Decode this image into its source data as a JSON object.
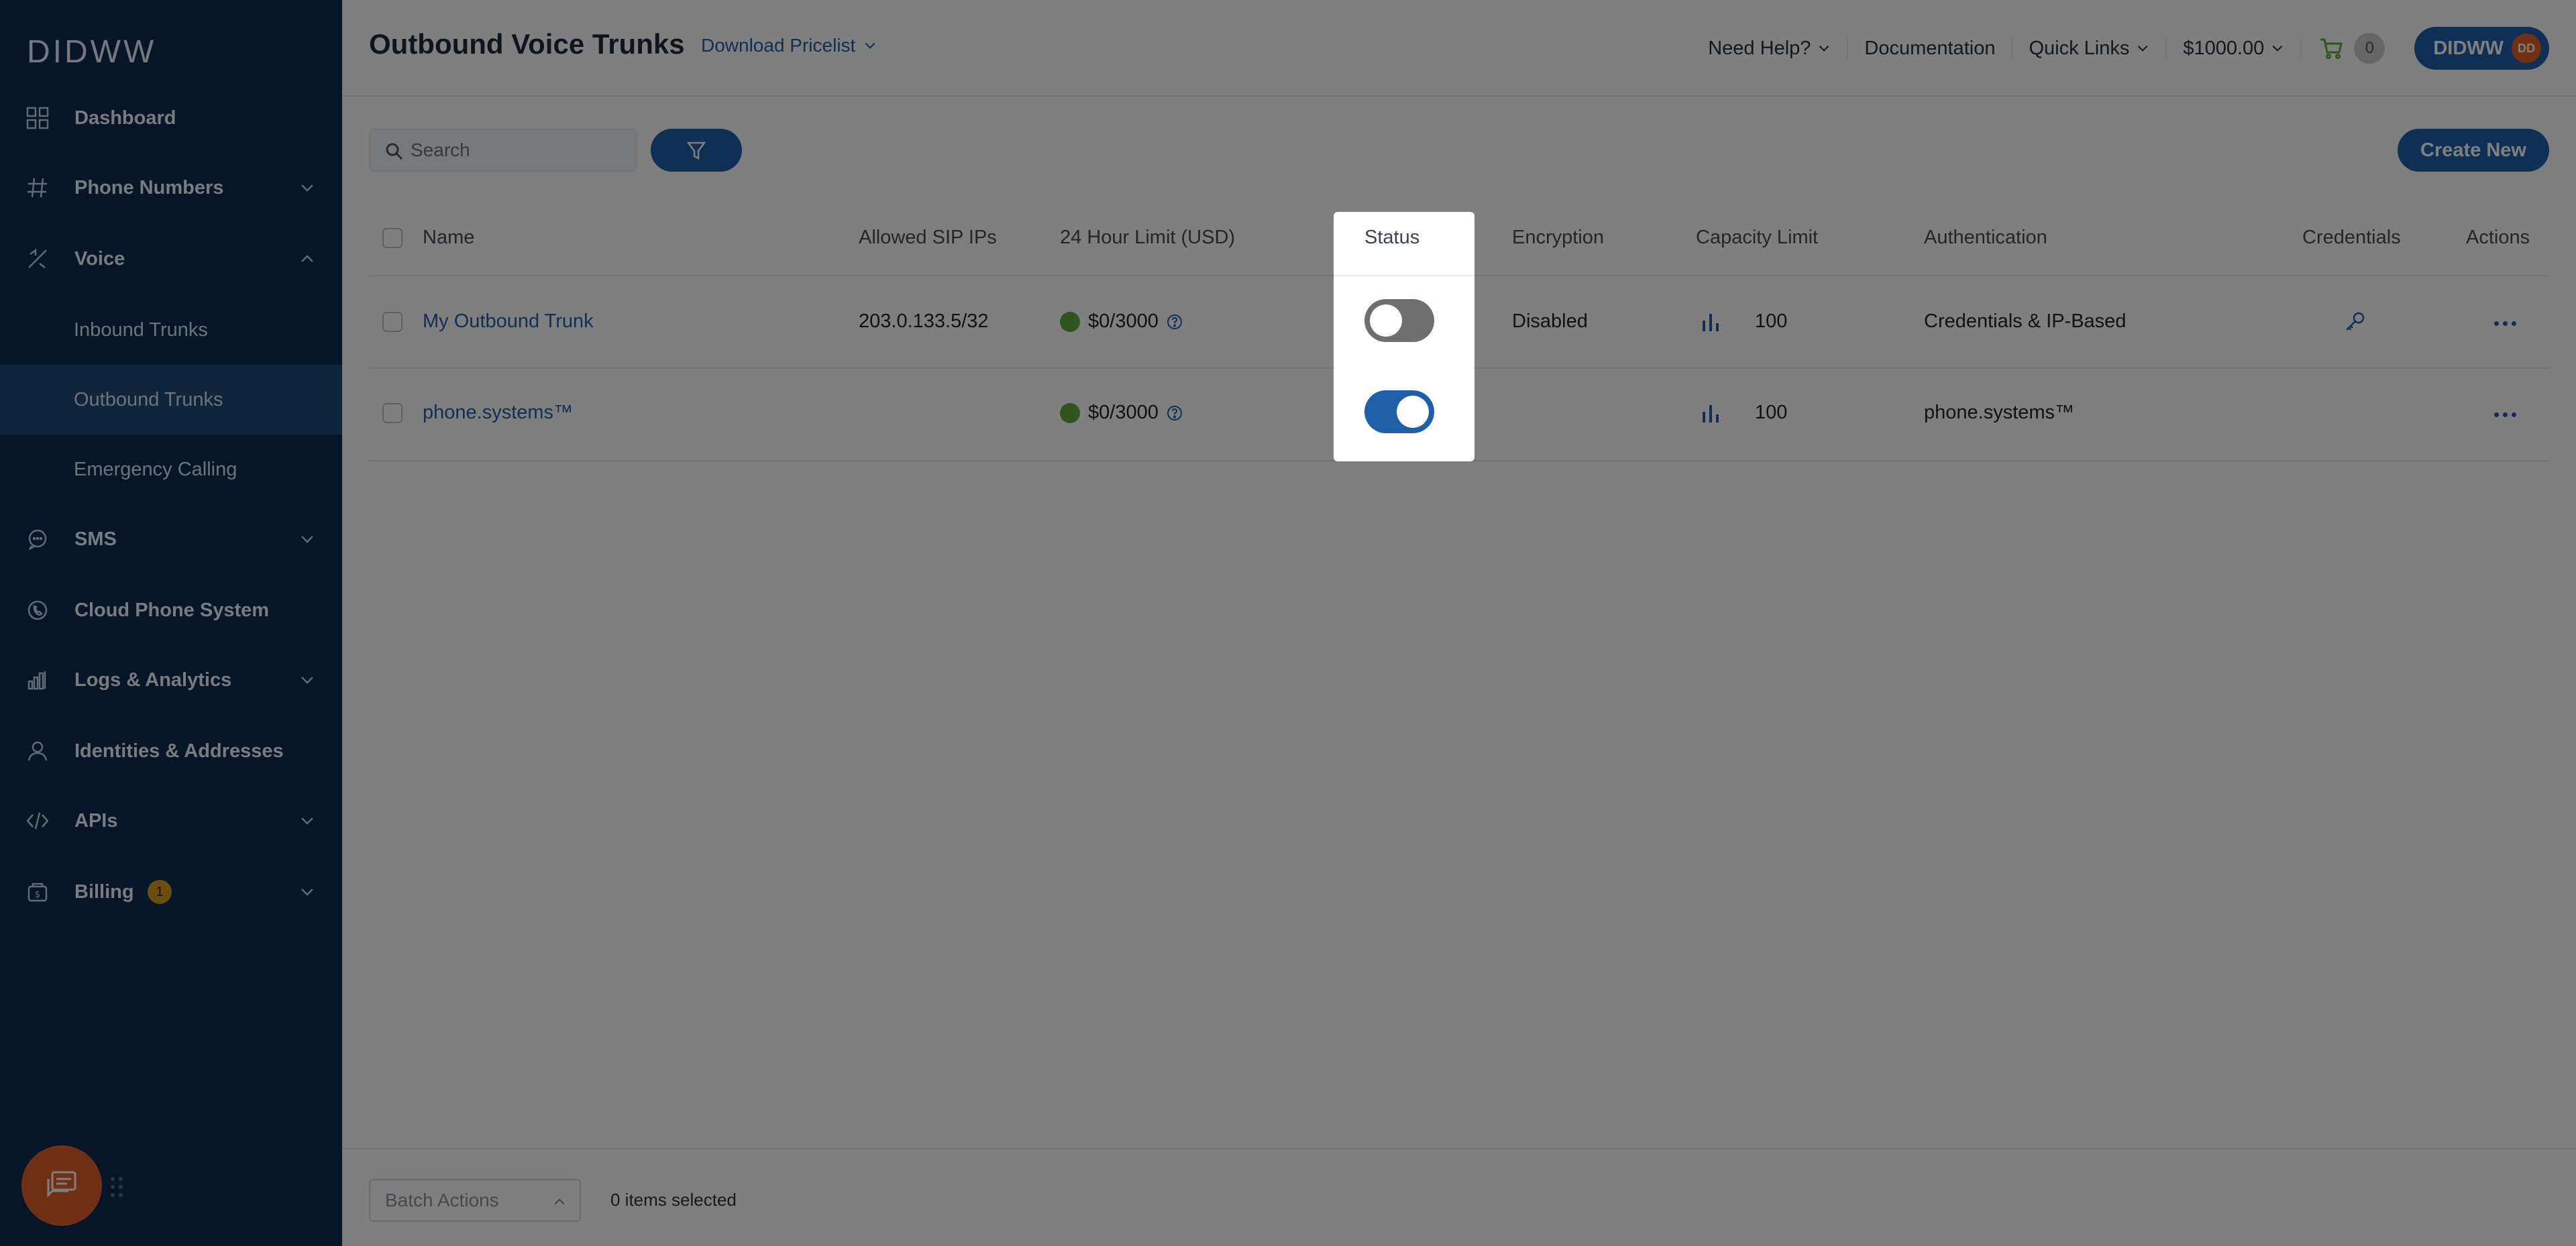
{
  "sidebar": {
    "logo": "DIDWW",
    "items": [
      {
        "label": "Dashboard"
      },
      {
        "label": "Phone Numbers"
      },
      {
        "label": "Voice"
      },
      {
        "label": "SMS"
      },
      {
        "label": "Cloud Phone System"
      },
      {
        "label": "Logs & Analytics"
      },
      {
        "label": "Identities & Addresses"
      },
      {
        "label": "APIs"
      },
      {
        "label": "Billing",
        "badge": "1"
      }
    ],
    "voice_sub": [
      {
        "label": "Inbound Trunks"
      },
      {
        "label": "Outbound Trunks",
        "active": true
      },
      {
        "label": "Emergency Calling"
      }
    ]
  },
  "header": {
    "title": "Outbound Voice Trunks",
    "pricelist": "Download Pricelist",
    "need_help": "Need Help?",
    "documentation": "Documentation",
    "quick_links": "Quick Links",
    "balance": "$1000.00",
    "cart_count": "0",
    "account": "DIDWW",
    "avatar_initials": "DD"
  },
  "toolbar": {
    "search_placeholder": "Search",
    "create_label": "Create New"
  },
  "table": {
    "columns": {
      "name": "Name",
      "allowed_ips": "Allowed SIP IPs",
      "limit": "24 Hour Limit (USD)",
      "status": "Status",
      "encryption": "Encryption",
      "capacity": "Capacity Limit",
      "authentication": "Authentication",
      "credentials": "Credentials",
      "actions": "Actions"
    },
    "rows": [
      {
        "name": "My Outbound Trunk",
        "allowed_ips": "203.0.133.5/32",
        "limit": "$0/3000",
        "status_on": false,
        "encryption": "Disabled",
        "capacity": "100",
        "authentication": "Credentials & IP-Based"
      },
      {
        "name": "phone.systems™",
        "allowed_ips": "",
        "limit": "$0/3000",
        "status_on": true,
        "encryption": "",
        "capacity": "100",
        "authentication": "phone.systems™"
      }
    ]
  },
  "footer": {
    "batch_actions": "Batch Actions",
    "selected": "0 items selected"
  },
  "colors": {
    "sidebar_bg": "#0c2a4e",
    "accent": "#1f5fa8",
    "active_sub": "#1d4a79",
    "status_dot": "#5fa83a",
    "chat_fab": "#e0612a",
    "badge": "#d69a1e"
  }
}
